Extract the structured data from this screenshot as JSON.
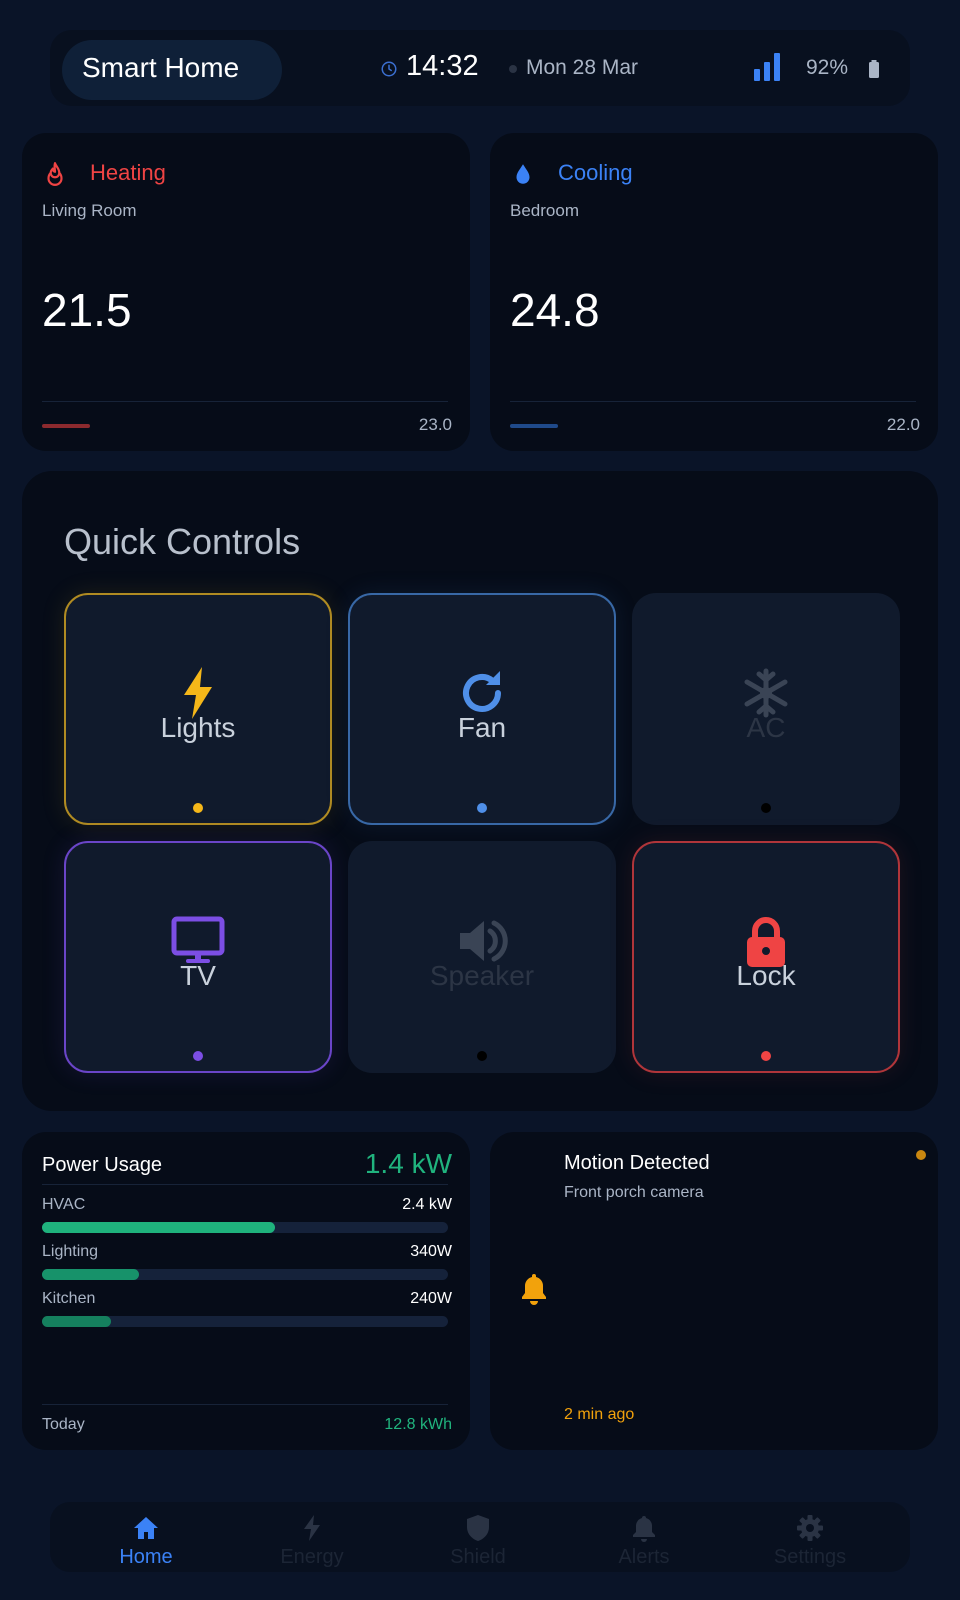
{
  "colors": {
    "background": "#0a1428",
    "heating": "#ef4444",
    "cooling": "#3b82f6",
    "accent_green": "#20b47e",
    "alert_orange": "#f2a20c",
    "lights": "#f5b719",
    "fan": "#4f8fe8",
    "tv": "#7c4ee4",
    "lock": "#ef4444",
    "inactive": "#3a4455"
  },
  "status_bar": {
    "title": "Smart Home",
    "time": "14:32",
    "date": "Mon 28 Mar",
    "battery": "92%",
    "icons": [
      "clock-icon",
      "signal-icon",
      "battery-icon"
    ]
  },
  "climate": [
    {
      "mode": "Heating",
      "icon": "flame-icon",
      "room": "Living Room",
      "temperature": "21.5",
      "target": "23.0"
    },
    {
      "mode": "Cooling",
      "icon": "droplet-icon",
      "room": "Bedroom",
      "temperature": "24.8",
      "target": "22.0"
    }
  ],
  "quick_controls": {
    "title": "Quick Controls",
    "tiles": [
      {
        "label": "Lights",
        "icon": "bolt-icon",
        "state": "on"
      },
      {
        "label": "Fan",
        "icon": "refresh-icon",
        "state": "on"
      },
      {
        "label": "AC",
        "icon": "snowflake-icon",
        "state": "off"
      },
      {
        "label": "TV",
        "icon": "tv-icon",
        "state": "on"
      },
      {
        "label": "Speaker",
        "icon": "speaker-icon",
        "state": "off"
      },
      {
        "label": "Lock",
        "icon": "lock-icon",
        "state": "on"
      }
    ]
  },
  "power": {
    "title": "Power Usage",
    "total": "1.4 kW",
    "rows": [
      {
        "label": "HVAC",
        "value": "2.4 kW",
        "fraction": 0.575
      },
      {
        "label": "Lighting",
        "value": "340W",
        "fraction": 0.24
      },
      {
        "label": "Kitchen",
        "value": "240W",
        "fraction": 0.17
      }
    ],
    "today_label": "Today",
    "today_value": "12.8 kWh"
  },
  "alert": {
    "title": "Motion Detected",
    "subtitle": "Front porch camera",
    "time": "2 min ago",
    "icon": "bell-icon"
  },
  "nav": {
    "items": [
      {
        "label": "Home",
        "icon": "home-icon",
        "active": true
      },
      {
        "label": "Energy",
        "icon": "bolt-icon",
        "active": false
      },
      {
        "label": "Shield",
        "icon": "shield-icon",
        "active": false
      },
      {
        "label": "Alerts",
        "icon": "bell-icon",
        "active": false
      },
      {
        "label": "Settings",
        "icon": "gear-icon",
        "active": false
      }
    ]
  }
}
